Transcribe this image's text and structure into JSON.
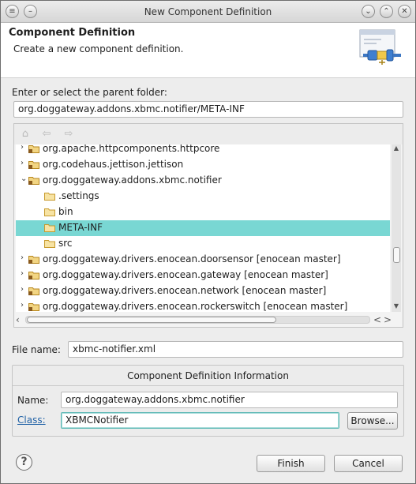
{
  "window": {
    "title": "New Component Definition"
  },
  "banner": {
    "title": "Component Definition",
    "description": "Create a new component definition."
  },
  "parent_folder": {
    "label": "Enter or select the parent folder:",
    "value": "org.doggateway.addons.xbmc.notifier/META-INF"
  },
  "tree": {
    "rows": [
      {
        "label": "org.apache.httpcomponents.httpcore",
        "expander": "collapsed"
      },
      {
        "label": "org.codehaus.jettison.jettison",
        "expander": "collapsed"
      },
      {
        "label": "org.doggateway.addons.xbmc.notifier",
        "expander": "expanded"
      },
      {
        "label": ".settings",
        "expander": "none"
      },
      {
        "label": "bin",
        "expander": "none"
      },
      {
        "label": "META-INF",
        "expander": "none",
        "selected": true
      },
      {
        "label": "src",
        "expander": "none"
      },
      {
        "label": "org.doggateway.drivers.enocean.doorsensor  [enocean master]",
        "expander": "collapsed"
      },
      {
        "label": "org.doggateway.drivers.enocean.gateway  [enocean master]",
        "expander": "collapsed"
      },
      {
        "label": "org.doggateway.drivers.enocean.network  [enocean master]",
        "expander": "collapsed"
      },
      {
        "label": "org.doggateway.drivers.enocean.rockerswitch  [enocean master]",
        "expander": "collapsed"
      }
    ]
  },
  "file_name": {
    "label": "File name:",
    "value": "xbmc-notifier.xml"
  },
  "group": {
    "title": "Component Definition Information",
    "name_label": "Name:",
    "name_value": "org.doggateway.addons.xbmc.notifier",
    "class_label": "Class:",
    "class_value": "XBMCNotifier",
    "browse_label": "Browse..."
  },
  "buttons": {
    "finish": "Finish",
    "cancel": "Cancel"
  },
  "colors": {
    "selection": "#79d7d3",
    "link": "#2162a6",
    "focus_border": "#5fb9b6"
  },
  "icons": {
    "window_menu": "window-menu-icon",
    "minimize": "minimize-icon",
    "maximize": "maximize-icon",
    "close": "close-icon",
    "wizard": "plug-wizard-icon",
    "home": "home-icon",
    "back": "back-arrow-icon",
    "forward": "forward-arrow-icon",
    "folder": "folder-icon",
    "project": "project-icon",
    "help": "help-icon"
  }
}
